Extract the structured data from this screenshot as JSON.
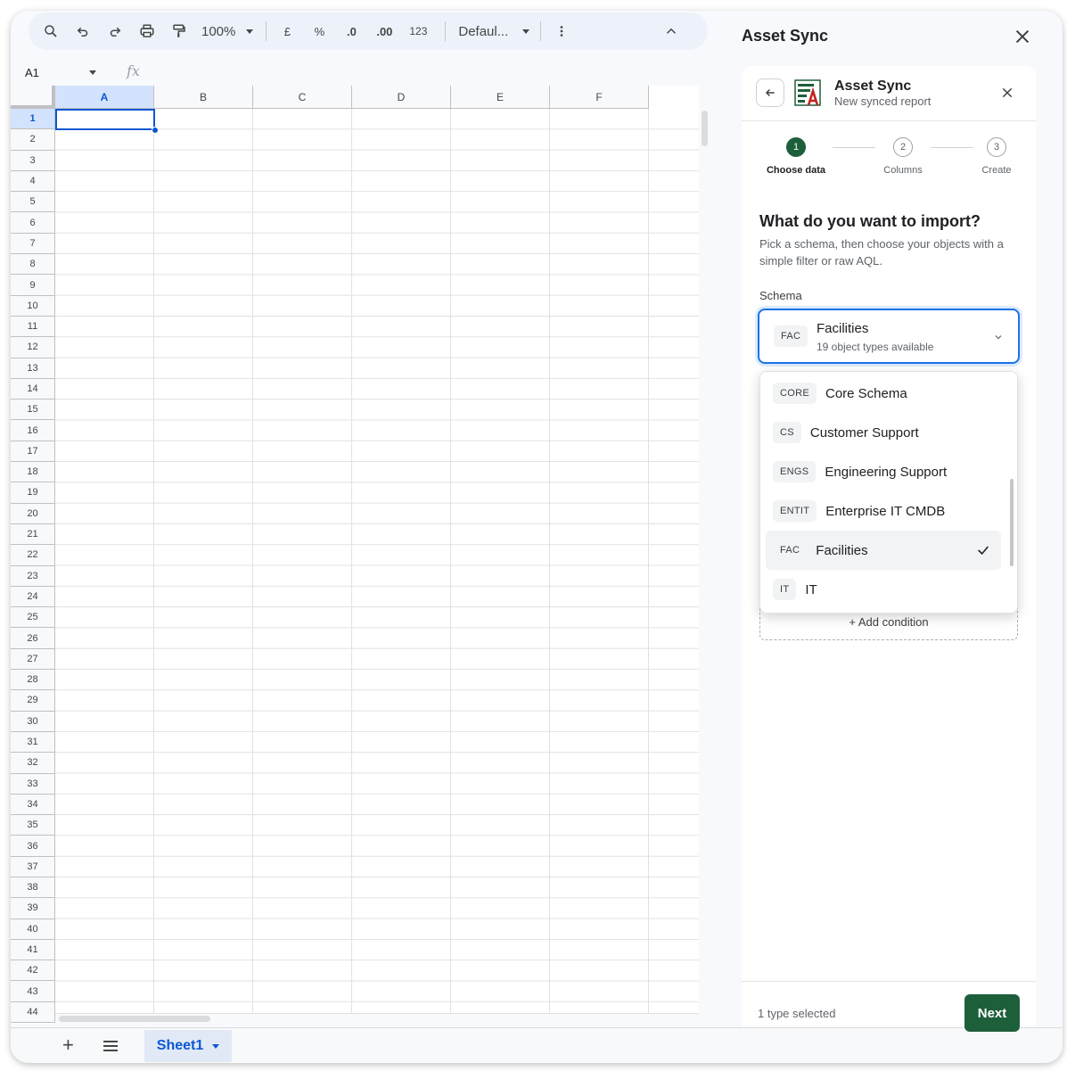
{
  "toolbar": {
    "zoom": "100%",
    "currency": "£",
    "percent": "%",
    "decrease_decimal": ".0",
    "increase_decimal": ".00",
    "number_format": "123",
    "font": "Defaul..."
  },
  "formula_bar": {
    "cell_ref": "A1",
    "fx": "fx"
  },
  "grid": {
    "columns": [
      "A",
      "B",
      "C",
      "D",
      "E",
      "F"
    ],
    "rows": [
      "1",
      "2",
      "3",
      "4",
      "5",
      "6",
      "7",
      "8",
      "9",
      "10",
      "11",
      "12",
      "13",
      "14",
      "15",
      "16",
      "17",
      "18",
      "19",
      "20",
      "21",
      "22",
      "23",
      "24",
      "25",
      "26",
      "27",
      "28",
      "29",
      "30",
      "31",
      "32",
      "33",
      "34",
      "35",
      "36",
      "37",
      "38",
      "39",
      "40",
      "41",
      "42",
      "43",
      "44"
    ]
  },
  "sheet_tabs": {
    "add": "+",
    "active": "Sheet1"
  },
  "side_panel": {
    "title": "Asset Sync",
    "app_name": "Asset Sync",
    "app_subtitle": "New synced report",
    "steps": [
      {
        "num": "1",
        "label": "Choose data"
      },
      {
        "num": "2",
        "label": "Columns"
      },
      {
        "num": "3",
        "label": "Create"
      }
    ],
    "question": "What do you want to import?",
    "description": "Pick a schema, then choose your objects with a simple filter or raw AQL.",
    "schema_label": "Schema",
    "selected": {
      "code": "FAC",
      "name": "Facilities",
      "subtitle": "19 object types available"
    },
    "options": [
      {
        "code": "CORE",
        "name": "Core Schema"
      },
      {
        "code": "CS",
        "name": "Customer Support"
      },
      {
        "code": "ENGS",
        "name": "Engineering Support"
      },
      {
        "code": "ENTIT",
        "name": "Enterprise IT CMDB"
      },
      {
        "code": "FAC",
        "name": "Facilities"
      },
      {
        "code": "IT",
        "name": "IT"
      }
    ],
    "add_condition": "+ Add condition",
    "footer_text": "1 type selected",
    "next": "Next"
  },
  "colors": {
    "accent": "#1e5f3b",
    "focus": "#1a73e8",
    "sheet_blue": "#0b57d0"
  }
}
